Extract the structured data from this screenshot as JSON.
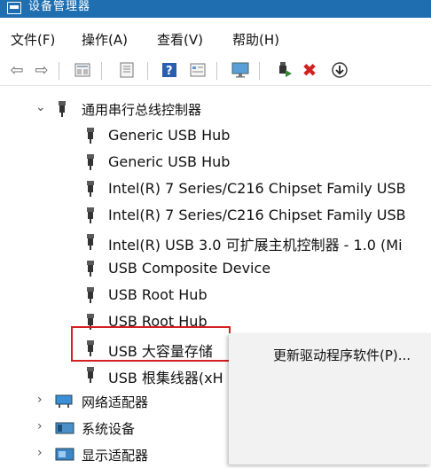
{
  "window": {
    "title": "设备管理器"
  },
  "menu": [
    {
      "label": "文件(F)"
    },
    {
      "label": "操作(A)"
    },
    {
      "label": "查看(V)"
    },
    {
      "label": "帮助(H)"
    }
  ],
  "toolbar": {
    "icons": [
      "back-arrow-icon",
      "forward-arrow-icon",
      "properties-icon",
      "update-icon",
      "help-icon",
      "details-icon",
      "monitor-icon",
      "enable-device-icon",
      "uninstall-x-icon",
      "download-icon"
    ],
    "colors": {
      "accent": "#1f6fb0",
      "uninstall": "#d32020",
      "enable": "#2e8b2e"
    }
  },
  "tree": {
    "category": "通用串行总线控制器",
    "devices": [
      {
        "label": "Generic USB Hub"
      },
      {
        "label": "Generic USB Hub"
      },
      {
        "label": "Intel(R) 7 Series/C216 Chipset Family USB"
      },
      {
        "label": "Intel(R) 7 Series/C216 Chipset Family USB"
      },
      {
        "label": "Intel(R) USB 3.0 可扩展主机控制器 - 1.0 (Mi"
      },
      {
        "label": "USB Composite Device"
      },
      {
        "label": "USB Root Hub"
      },
      {
        "label": "USB Root Hub"
      },
      {
        "label": "USB 大容量存储"
      },
      {
        "label": "USB 根集线器(xH"
      }
    ],
    "other_categories": [
      {
        "label": "网络适配器"
      },
      {
        "label": "系统设备"
      },
      {
        "label": "显示适配器"
      }
    ]
  },
  "context_menu": {
    "items": [
      {
        "label": "更新驱动程序软件(P)..."
      }
    ]
  }
}
